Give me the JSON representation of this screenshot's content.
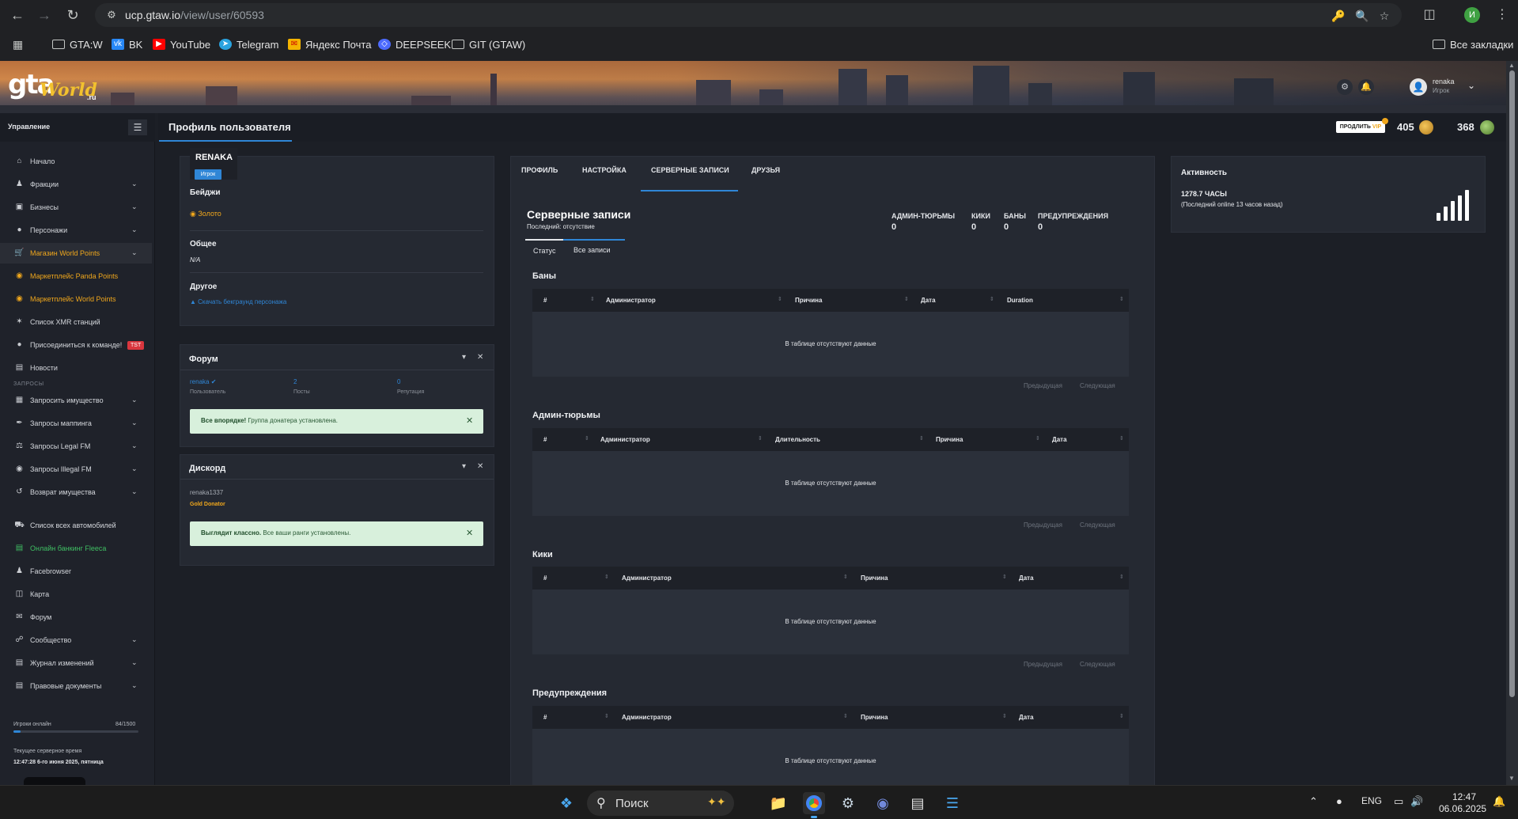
{
  "browser": {
    "url_host": "ucp.gtaw.io",
    "url_path": "/view/user/60593",
    "profile_initial": "И",
    "bookmarks": [
      {
        "label": "GTA:W",
        "icon": "folder-icon"
      },
      {
        "label": "BK",
        "icon": "vk-icon"
      },
      {
        "label": "YouTube",
        "icon": "youtube-icon"
      },
      {
        "label": "Telegram",
        "icon": "telegram-icon"
      },
      {
        "label": "Яндекс Почта",
        "icon": "yandex-mail-icon"
      },
      {
        "label": "DEEPSEEK",
        "icon": "deepseek-icon"
      },
      {
        "label": "GIT (GTAW)",
        "icon": "folder-icon"
      }
    ],
    "all_bookmarks": "Все закладки"
  },
  "site": {
    "logo_main": "gta",
    "logo_world": "World",
    "logo_ru": ".ru",
    "user_name": "renaka",
    "user_role": "Игрок"
  },
  "sidebar": {
    "title": "Управление",
    "items": [
      {
        "label": "Начало",
        "icon": "home-icon"
      },
      {
        "label": "Фракции",
        "icon": "users-icon"
      },
      {
        "label": "Бизнесы",
        "icon": "briefcase-icon"
      },
      {
        "label": "Персонажи",
        "icon": "user-icon"
      },
      {
        "label": "Магазин World Points",
        "icon": "cart-icon"
      },
      {
        "label": "Маркетплейс Panda Points",
        "icon": "coins-icon"
      },
      {
        "label": "Маркетплейс World Points",
        "icon": "coins-icon"
      },
      {
        "label": "Список XMR станций",
        "icon": "antenna-icon"
      },
      {
        "label": "Присоединиться к команде!",
        "icon": "user-plus-icon",
        "badge": "TST"
      },
      {
        "label": "Новости",
        "icon": "newspaper-icon"
      }
    ],
    "section_requests": "ЗАПРОСЫ",
    "request_items": [
      {
        "label": "Запросить имущество",
        "icon": "building-icon"
      },
      {
        "label": "Запросы маппинга",
        "icon": "brush-icon"
      },
      {
        "label": "Запросы Legal FM",
        "icon": "scale-icon"
      },
      {
        "label": "Запросы Illegal FM",
        "icon": "mask-icon"
      },
      {
        "label": "Возврат имущества",
        "icon": "undo-icon"
      }
    ],
    "other_items": [
      {
        "label": "Список всех автомобилей",
        "icon": "car-icon"
      },
      {
        "label": "Онлайн банкинг Fleeca",
        "icon": "bank-icon"
      },
      {
        "label": "Facebrowser",
        "icon": "users-icon"
      },
      {
        "label": "Карта",
        "icon": "map-icon"
      },
      {
        "label": "Форум",
        "icon": "comments-icon"
      },
      {
        "label": "Сообщество",
        "icon": "share-icon"
      },
      {
        "label": "Журнал изменений",
        "icon": "log-icon"
      },
      {
        "label": "Правовые документы",
        "icon": "docs-icon"
      }
    ],
    "online_label": "Игроки онлайн",
    "online_count": "84/1500",
    "online_fraction": 0.056,
    "time_label": "Текущее серверное время",
    "time_value": "12:47:28 6-го июня 2025, пятница"
  },
  "header": {
    "page_title": "Профиль пользователя",
    "vip_label": "ПРОДЛИТЬ",
    "vip_suffix": "VIP",
    "coins_world": "405",
    "coins_panda": "368"
  },
  "profile": {
    "name": "RENAKA",
    "role": "Игрок",
    "badges_title": "Бейджи",
    "badge_gold": "Золото",
    "general_title": "Общее",
    "general_value": "N/A",
    "other_title": "Другое",
    "download_bg": "Скачать бекграунд персонажа"
  },
  "forum": {
    "title": "Форум",
    "user": "renaka",
    "user_label": "Пользователь",
    "posts": "2",
    "posts_label": "Посты",
    "rep": "0",
    "rep_label": "Репутация",
    "alert_bold": "Все впорядке!",
    "alert_text": " Группа донатера установлена."
  },
  "discord": {
    "title": "Дискорд",
    "user": "renaka1337",
    "rank": "Gold Donator",
    "alert_bold": "Выглядит классно.",
    "alert_text": " Все ваши ранги установлены."
  },
  "center": {
    "tabs": [
      "ПРОФИЛЬ",
      "НАСТРОЙКА",
      "СЕРВЕРНЫЕ ЗАПИСИ",
      "ДРУЗЬЯ"
    ],
    "title": "Серверные записи",
    "subtitle": "Последний: отсутствие",
    "stats": [
      {
        "label": "АДМИН-ТЮРЬМЫ",
        "value": "0"
      },
      {
        "label": "КИКИ",
        "value": "0"
      },
      {
        "label": "БАНЫ",
        "value": "0"
      },
      {
        "label": "ПРЕДУПРЕЖДЕНИЯ",
        "value": "0"
      }
    ],
    "subtabs": [
      "Статус",
      "Все записи"
    ],
    "empty_text": "В таблице отсутствуют данные",
    "prev": "Предыдущая",
    "next": "Следующая",
    "bans": {
      "title": "Баны",
      "columns": [
        "#",
        "Администратор",
        "Причина",
        "Дата",
        "Duration"
      ]
    },
    "jails": {
      "title": "Админ-тюрьмы",
      "columns": [
        "#",
        "Администратор",
        "Длительность",
        "Причина",
        "Дата"
      ]
    },
    "kicks": {
      "title": "Кики",
      "columns": [
        "#",
        "Администратор",
        "Причина",
        "Дата"
      ]
    },
    "warns": {
      "title": "Предупреждения",
      "columns": [
        "#",
        "Администратор",
        "Причина",
        "Дата"
      ]
    }
  },
  "activity": {
    "title": "Активность",
    "hours": "1278.7 ЧАСЫ",
    "last_online": "(Последний online 13 часов назад)"
  },
  "taskbar": {
    "search": "Поиск",
    "lang": "ENG",
    "time": "12:47",
    "date": "06.06.2025"
  }
}
